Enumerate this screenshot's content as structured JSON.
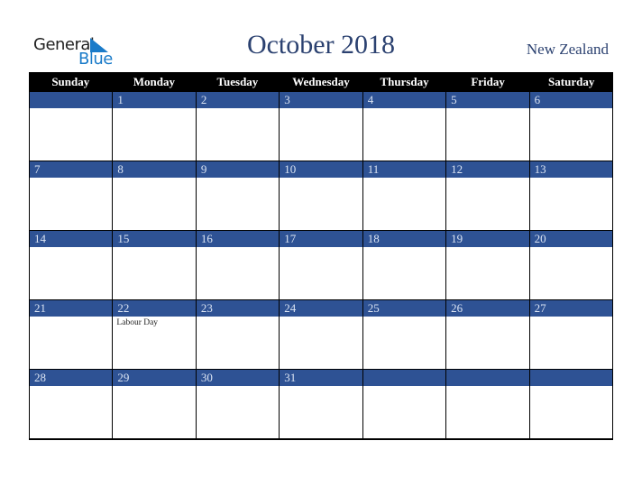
{
  "logo": {
    "word1": "General",
    "word2": "Blue"
  },
  "header": {
    "title": "October 2018",
    "country": "New Zealand"
  },
  "colors": {
    "band": "#2e5294",
    "header_bg": "#000000",
    "title": "#2b4170",
    "logo_blue": "#1a7bc9"
  },
  "weekdays": [
    "Sunday",
    "Monday",
    "Tuesday",
    "Wednesday",
    "Thursday",
    "Friday",
    "Saturday"
  ],
  "weeks": [
    [
      {
        "day": ""
      },
      {
        "day": "1"
      },
      {
        "day": "2"
      },
      {
        "day": "3"
      },
      {
        "day": "4"
      },
      {
        "day": "5"
      },
      {
        "day": "6"
      }
    ],
    [
      {
        "day": "7"
      },
      {
        "day": "8"
      },
      {
        "day": "9"
      },
      {
        "day": "10"
      },
      {
        "day": "11"
      },
      {
        "day": "12"
      },
      {
        "day": "13"
      }
    ],
    [
      {
        "day": "14"
      },
      {
        "day": "15"
      },
      {
        "day": "16"
      },
      {
        "day": "17"
      },
      {
        "day": "18"
      },
      {
        "day": "19"
      },
      {
        "day": "20"
      }
    ],
    [
      {
        "day": "21"
      },
      {
        "day": "22",
        "event": "Labour Day"
      },
      {
        "day": "23"
      },
      {
        "day": "24"
      },
      {
        "day": "25"
      },
      {
        "day": "26"
      },
      {
        "day": "27"
      }
    ],
    [
      {
        "day": "28"
      },
      {
        "day": "29"
      },
      {
        "day": "30"
      },
      {
        "day": "31"
      },
      {
        "day": ""
      },
      {
        "day": ""
      },
      {
        "day": ""
      }
    ]
  ]
}
